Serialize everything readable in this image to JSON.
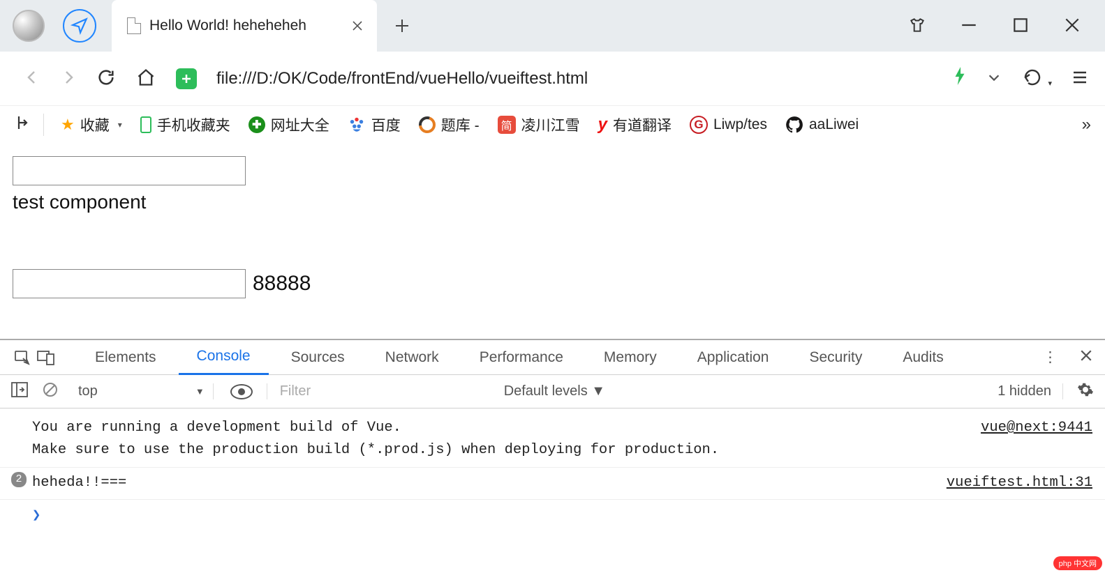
{
  "window": {
    "tab_title": "Hello World! heheheheh",
    "url": "file:///D:/OK/Code/frontEnd/vueHello/vueiftest.html"
  },
  "bookmarks": {
    "fav_label": "收藏",
    "mobile_fav": "手机收藏夹",
    "items": [
      {
        "label": "网址大全",
        "icon": "360"
      },
      {
        "label": "百度",
        "icon": "baidu"
      },
      {
        "label": "题库 -",
        "icon": "tiku"
      },
      {
        "label": "凌川江雪",
        "icon": "jian"
      },
      {
        "label": "有道翻译",
        "icon": "youdao"
      },
      {
        "label": "Liwp/tes",
        "icon": "gitee"
      },
      {
        "label": "aaLiwei",
        "icon": "github"
      }
    ]
  },
  "page": {
    "input1_value": "",
    "text1": "test component",
    "input2_value": "",
    "text2": "88888"
  },
  "devtools": {
    "tabs": [
      "Elements",
      "Console",
      "Sources",
      "Network",
      "Performance",
      "Memory",
      "Application",
      "Security",
      "Audits"
    ],
    "active_tab": "Console",
    "context": "top",
    "filter_placeholder": "Filter",
    "levels": "Default levels ▼",
    "hidden": "1 hidden",
    "console": {
      "msg1_line1": "You are running a development build of Vue.",
      "msg1_line2": "Make sure to use the production build (*.prod.js) when deploying for production.",
      "msg1_src": "vue@next:9441",
      "msg2_count": "2",
      "msg2_text": "heheda!!===",
      "msg2_src": "vueiftest.html:31"
    }
  },
  "watermark": "php 中文网"
}
